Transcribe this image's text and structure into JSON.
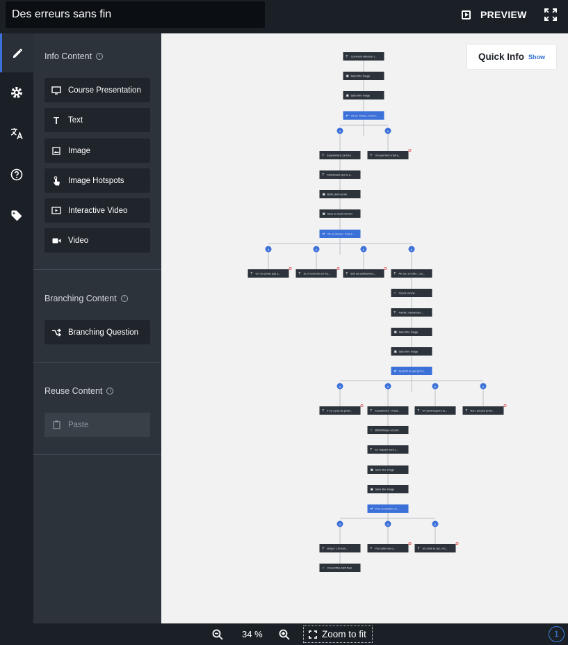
{
  "header": {
    "title": "Des erreurs sans fin",
    "preview_label": "PREVIEW"
  },
  "rail": {
    "items": [
      {
        "icon": "pencil-icon",
        "active": true
      },
      {
        "icon": "gear-icon",
        "active": false
      },
      {
        "icon": "translate-icon",
        "active": false
      },
      {
        "icon": "help-icon",
        "active": false
      },
      {
        "icon": "tag-icon",
        "active": false
      }
    ]
  },
  "sidebar": {
    "info_content": {
      "title": "Info Content",
      "items": [
        {
          "label": "Course Presentation",
          "icon": "presentation-icon"
        },
        {
          "label": "Text",
          "icon": "text-icon"
        },
        {
          "label": "Image",
          "icon": "image-icon"
        },
        {
          "label": "Image Hotspots",
          "icon": "hotspot-hand-icon"
        },
        {
          "label": "Interactive Video",
          "icon": "interactive-video-icon"
        },
        {
          "label": "Video",
          "icon": "video-camera-icon"
        }
      ]
    },
    "branching_content": {
      "title": "Branching Content",
      "items": [
        {
          "label": "Branching Question",
          "icon": "branching-icon"
        }
      ]
    },
    "reuse_content": {
      "title": "Reuse Content",
      "items": [
        {
          "label": "Paste",
          "icon": "paste-icon",
          "disabled": true
        }
      ]
    }
  },
  "canvas": {
    "quick_info": {
      "title": "Quick Info",
      "show_label": "Show"
    },
    "colors": {
      "node_dark": "#2d333b",
      "node_branch": "#3b70d9",
      "alt_dot": "#3b70d9",
      "edge": "#b9bec4",
      "warn": "#e05252"
    },
    "nodes": [
      {
        "label": "Comment effectuer l...",
        "type": "text"
      },
      {
        "label": "Sans titre Image",
        "type": "image"
      },
      {
        "label": "Sans titre Image",
        "type": "image"
      },
      {
        "label": "Vis ce niveau : Erreur...",
        "type": "branch"
      },
      {
        "label": "Exactement, j'ai tout...",
        "type": "text"
      },
      {
        "label": "On peut tout à fait a...",
        "type": "text"
      },
      {
        "label": "Maintenant que le p...",
        "type": "text"
      },
      {
        "label": "Boîte plein écran",
        "type": "image"
      },
      {
        "label": "Sous le circuit numéri",
        "type": "image"
      },
      {
        "label": "Vis ce niveau : Erreur...",
        "type": "branch"
      },
      {
        "label": "On n'a certes pas e...",
        "type": "text"
      },
      {
        "label": "Si, il n'est bien un AC...",
        "type": "text"
      },
      {
        "label": "Elle est suffisamme...",
        "type": "text"
      },
      {
        "label": "Ah oui, en effet ...Ce...",
        "type": "text"
      },
      {
        "label": "Circuit vérsné",
        "type": "hotspot"
      },
      {
        "label": "Parfait, maintenant ...",
        "type": "text"
      },
      {
        "label": "Sans titre Image",
        "type": "image"
      },
      {
        "label": "Sans titre Image",
        "type": "image"
      },
      {
        "label": "Quelest ce que j'ai ce...",
        "type": "branch"
      },
      {
        "label": "Il n'y a pas de probl...",
        "type": "text"
      },
      {
        "label": "Exactement : Il faut ...",
        "type": "text"
      },
      {
        "label": "On peut toujours ra...",
        "type": "text"
      },
      {
        "label": "Non, aucune probl...",
        "type": "text"
      },
      {
        "label": "Bibliothèque et prod...",
        "type": "hotspot"
      },
      {
        "label": "En cliquant sans l...",
        "type": "text"
      },
      {
        "label": "Sans titre Image",
        "type": "image"
      },
      {
        "label": "Sans titre Image",
        "type": "image"
      },
      {
        "label": "Pour la dernière fo...",
        "type": "branch"
      },
      {
        "label": "Bingo ! L'érreuh...",
        "type": "text"
      },
      {
        "label": "Pas cette lois-ci...",
        "type": "text"
      },
      {
        "label": "Si c'était le cas, l'eC...",
        "type": "text"
      },
      {
        "label": "Circuit filtre ADP final",
        "type": "hotspot"
      }
    ],
    "alt_label": "A"
  },
  "footer": {
    "zoom_level": "34 %",
    "zoom_fit_label": "Zoom to fit",
    "help_count": "1"
  }
}
